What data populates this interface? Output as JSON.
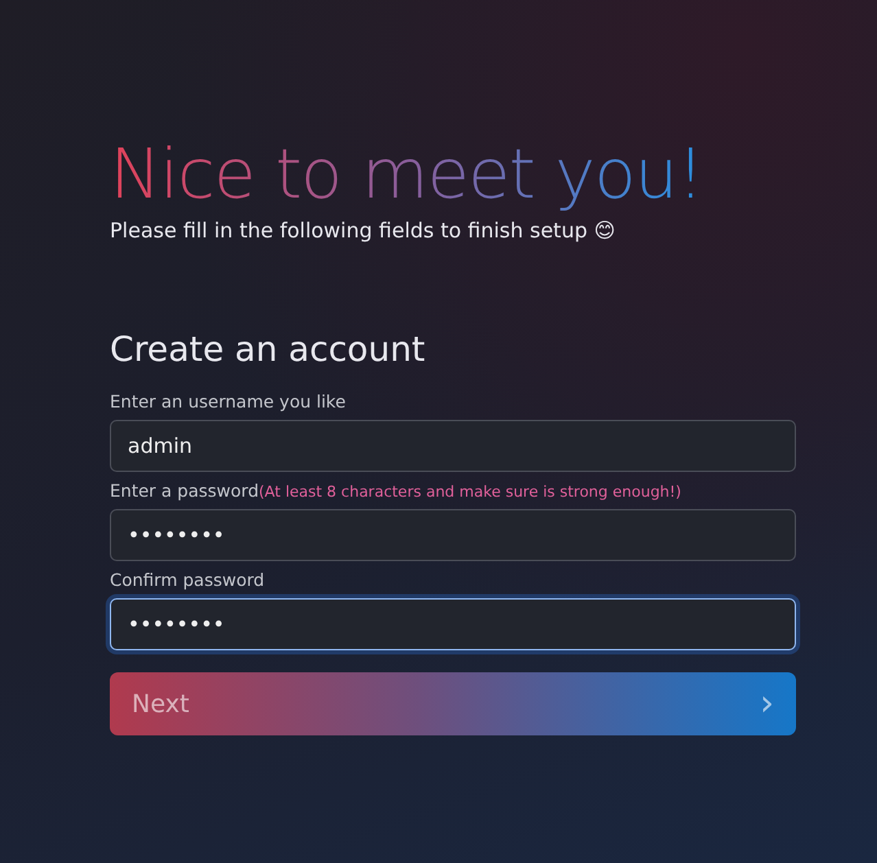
{
  "heading": {
    "title": "Nice to meet you!",
    "subtitle": "Please fill in the following fields to finish setup 😊"
  },
  "form": {
    "title": "Create an account",
    "fields": [
      {
        "label": "Enter an username you like",
        "value": "admin",
        "focused": false
      },
      {
        "label": "Enter a password",
        "hint": "(At least 8 characters and make sure is strong enough!)",
        "value": "••••••••",
        "focused": false
      },
      {
        "label": "Confirm password",
        "value": "••••••••",
        "focused": true
      }
    ],
    "button": {
      "label": "Next",
      "icon": "›",
      "disabled": true
    }
  }
}
